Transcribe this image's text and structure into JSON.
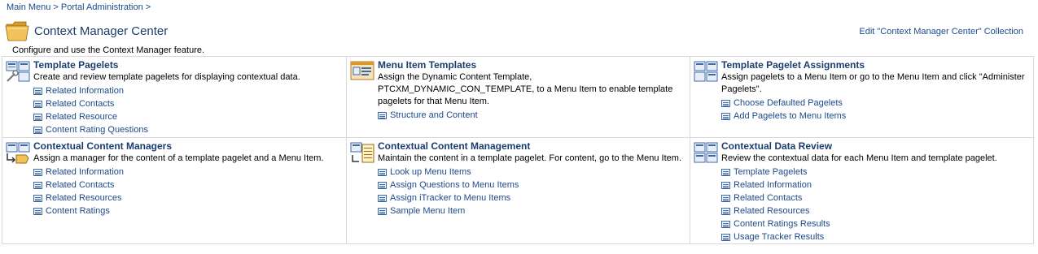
{
  "breadcrumb": {
    "items": [
      "Main Menu",
      "Portal Administration"
    ],
    "separator": ">"
  },
  "header": {
    "title": "Context Manager Center",
    "edit_link": "Edit \"Context Manager Center\" Collection",
    "description": "Configure and use the Context Manager feature."
  },
  "sections": [
    {
      "title": "Template Pagelets",
      "description": "Create and review template pagelets for displaying contextual data.",
      "links": [
        "Related Information",
        "Related Contacts",
        "Related Resource",
        "Content Rating Questions"
      ]
    },
    {
      "title": "Menu Item Templates",
      "description": "Assign the Dynamic Content Template, PTCXM_DYNAMIC_CON_TEMPLATE, to a Menu Item to enable template pagelets for that Menu Item.",
      "links": [
        "Structure and Content"
      ]
    },
    {
      "title": "Template Pagelet Assignments",
      "description": "Assign pagelets to a Menu Item or go to the Menu Item and click \"Administer Pagelets\".",
      "links": [
        "Choose Defaulted Pagelets",
        "Add Pagelets to Menu Items"
      ]
    },
    {
      "title": "Contextual Content Managers",
      "description": "Assign a manager for the content of a template pagelet and a Menu Item.",
      "links": [
        "Related Information",
        "Related Contacts",
        "Related Resources",
        "Content Ratings"
      ]
    },
    {
      "title": "Contextual Content Management",
      "description": "Maintain the content in a template pagelet. For content, go to the Menu Item.",
      "links": [
        "Look up Menu Items",
        "Assign Questions to Menu Items",
        "Assign iTracker to Menu Items",
        "Sample Menu Item"
      ]
    },
    {
      "title": "Contextual Data Review",
      "description": "Review the contextual data for each Menu Item and template pagelet.",
      "links": [
        "Template Pagelets",
        "Related Information",
        "Related Contacts",
        "Related Resources",
        "Content Ratings Results",
        "Usage Tracker Results"
      ]
    }
  ],
  "icons": {
    "folder": "folder-icon",
    "link": "list-link-icon"
  },
  "colors": {
    "link": "#1b4a8c",
    "title": "#1b3d6e",
    "border": "#d9d9d9"
  }
}
